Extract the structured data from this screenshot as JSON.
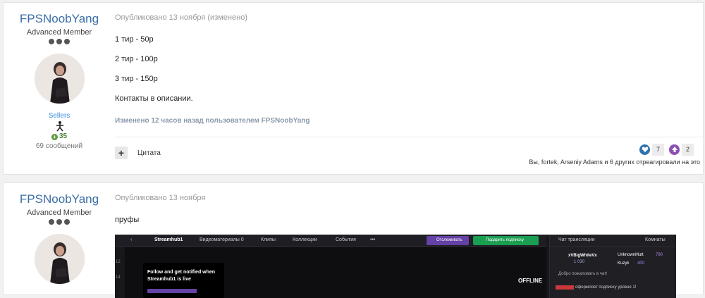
{
  "posts": [
    {
      "author": {
        "name": "FPSNoobYang",
        "title": "Advanced Member",
        "group": "Sellers",
        "reputation": "35",
        "messages": "69 сообщений"
      },
      "meta": "Опубликовано 13 ноября (изменено)",
      "lines": [
        "1 тир - 50р",
        "2 тир - 100р",
        "3 тир - 150р",
        "Контакты в описании."
      ],
      "edited_note": "Изменено 12 часов назад пользователем FPSNoobYang",
      "actions": {
        "plus_label": "+",
        "quote_label": "Цитата"
      },
      "reactions": [
        {
          "icon": "like-heart-icon",
          "count": "7",
          "color": "#2f73ad"
        },
        {
          "icon": "upvote-icon",
          "count": "2",
          "color": "#8c4fb3"
        }
      ],
      "reaction_summary": "Вы, fortek, Arseniy Adams и 6 других отреагировали на это"
    },
    {
      "author": {
        "name": "FPSNoobYang",
        "title": "Advanced Member"
      },
      "meta": "Опубликовано 13 ноября",
      "lines": [
        "пруфы"
      ],
      "embedded_screenshot": {
        "channel": "Streamhub1",
        "tabs": [
          "Видеоматериалы 0",
          "Клипы",
          "Коллекции",
          "События",
          "•••"
        ],
        "follow_button": "Отслеживать",
        "subscribe_button": "Подарить подписку",
        "chat_title": "Чат трансляции",
        "rooms_label": "Комнаты",
        "follow_card_line1": "Follow and get notified when",
        "follow_card_line2": "Streamhub1 is live",
        "offline_label": "OFFLINE",
        "chat_users": [
          "xVBigWhiteVx",
          "UnknownMutt",
          "Kuzyk"
        ],
        "chat_user_counts": [
          "1 030",
          "790",
          "400"
        ],
        "welcome": "Добро пожаловать в чат!",
        "sub_notice": "оформляет подписку уровня 1!",
        "gutter": [
          "12",
          "14"
        ]
      }
    }
  ],
  "colors": {
    "author_link": "#3a6ea5",
    "group": "#3a8de0",
    "reputation": "#4a7f36"
  }
}
